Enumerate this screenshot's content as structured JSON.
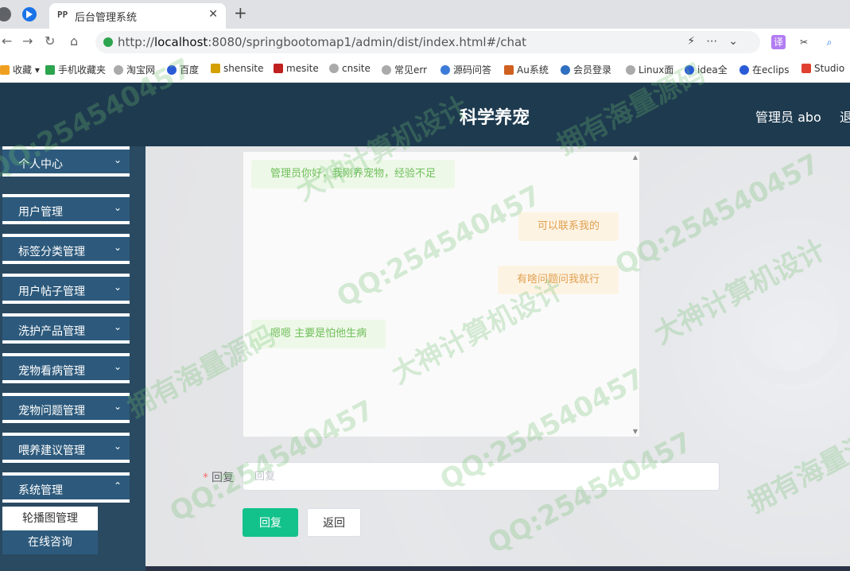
{
  "browser": {
    "tab_title": "后台管理系统",
    "tab_favicon": "PP",
    "address": {
      "prefix": "http://",
      "host": "localhost",
      "rest": ":8080/springbootomap1/admin/dist/index.html#/chat"
    },
    "bookmarks": [
      {
        "label": "收藏",
        "icon_color": "#f0a020"
      },
      {
        "label": "手机收藏夹",
        "icon_color": "#2da44e"
      },
      {
        "label": "淘宝网",
        "icon_color": "#888888"
      },
      {
        "label": "百度",
        "icon_color": "#2a5bd7"
      },
      {
        "label": "shensite",
        "icon_color": "#d4a000"
      },
      {
        "label": "mesite",
        "icon_color": "#c02020"
      },
      {
        "label": "cnsite",
        "icon_color": "#888888"
      },
      {
        "label": "常见err",
        "icon_color": "#888888"
      },
      {
        "label": "源码问答",
        "icon_color": "#3d7bd9"
      },
      {
        "label": "Au系统",
        "icon_color": "#d06020"
      },
      {
        "label": "会员登录",
        "icon_color": "#2f6fbf"
      },
      {
        "label": "Linux面",
        "icon_color": "#888888"
      },
      {
        "label": "idea全",
        "icon_color": "#2a5bd7"
      },
      {
        "label": "在eclips",
        "icon_color": "#2a5bd7"
      },
      {
        "label": "Studio",
        "icon_color": "#e04030"
      }
    ]
  },
  "header": {
    "title": "科学养宠",
    "admin": "管理员 abo",
    "logout": "退出"
  },
  "sidebar": {
    "menus": [
      {
        "label": "个人中心"
      },
      {
        "label": "用户管理"
      },
      {
        "label": "标签分类管理"
      },
      {
        "label": "用户帖子管理"
      },
      {
        "label": "洗护产品管理"
      },
      {
        "label": "宠物看病管理"
      },
      {
        "label": "宠物问题管理"
      },
      {
        "label": "喂养建议管理"
      },
      {
        "label": "系统管理"
      }
    ],
    "submenus": [
      {
        "label": "轮播图管理",
        "active": true
      },
      {
        "label": "在线咨询",
        "active": false
      }
    ]
  },
  "chat": {
    "messages": [
      {
        "side": "left",
        "text": "管理员你好，我刚养宠物，经验不足"
      },
      {
        "side": "right",
        "text": "可以联系我的"
      },
      {
        "side": "right",
        "text": "有啥问题问我就行"
      },
      {
        "side": "left",
        "text": "嗯嗯 主要是怕他生病"
      }
    ]
  },
  "form": {
    "label": "回复",
    "required_mark": "*",
    "placeholder": "回复",
    "value": "",
    "reply_button": "回复",
    "back_button": "返回"
  },
  "watermark": [
    "QQ:254540457",
    "大神计算机设计",
    "拥有海量源码",
    "QQ:254540457",
    "大神计算机设计",
    "拥有海量源码",
    "QQ:254540457",
    "大神计算机设计",
    "拥有海量源码",
    "QQ:254540457",
    "QQ:254540457",
    "QQ:254540457"
  ]
}
